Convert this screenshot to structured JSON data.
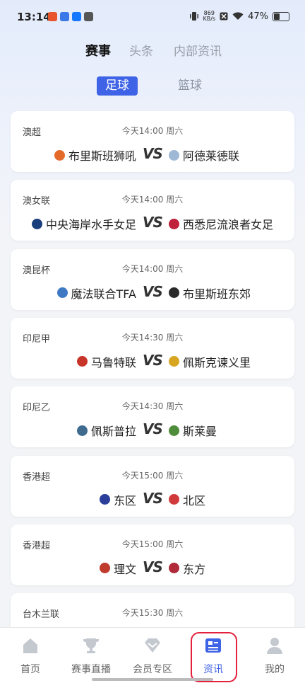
{
  "status": {
    "time": "13:14",
    "net_speed_value": "869",
    "net_speed_unit": "KB/s",
    "battery": "47%",
    "battery_level": 0.47
  },
  "top_tabs": [
    "赛事",
    "头条",
    "内部资讯"
  ],
  "sub_tabs": [
    "足球",
    "篮球"
  ],
  "vs_text": "VS",
  "matches": [
    {
      "league": "澳超",
      "time": "今天14:00 周六",
      "home": "布里斯班狮吼",
      "away": "阿德莱德联",
      "home_color": "#e46a2a",
      "away_color": "#9fb8d6"
    },
    {
      "league": "澳女联",
      "time": "今天14:00 周六",
      "home": "中央海岸水手女足",
      "away": "西悉尼流浪者女足",
      "home_color": "#1a3d7c",
      "away_color": "#c0213a"
    },
    {
      "league": "澳昆杯",
      "time": "今天14:00 周六",
      "home": "魔法联合TFA",
      "away": "布里斯班东郊",
      "home_color": "#3f79c4",
      "away_color": "#2a2a2a"
    },
    {
      "league": "印尼甲",
      "time": "今天14:30 周六",
      "home": "马鲁特联",
      "away": "佩斯克谏义里",
      "home_color": "#c7342a",
      "away_color": "#d8a521"
    },
    {
      "league": "印尼乙",
      "time": "今天14:30 周六",
      "home": "佩斯普拉",
      "away": "斯莱曼",
      "home_color": "#3f6b8f",
      "away_color": "#4f8d3a"
    },
    {
      "league": "香港超",
      "time": "今天15:00 周六",
      "home": "东区",
      "away": "北区",
      "home_color": "#2a3e9a",
      "away_color": "#d13a3a"
    },
    {
      "league": "香港超",
      "time": "今天15:00 周六",
      "home": "理文",
      "away": "东方",
      "home_color": "#c03a2e",
      "away_color": "#b02a3a"
    },
    {
      "league": "台木兰联",
      "time": "今天15:30 周六",
      "home": "",
      "away": "",
      "home_color": "#cccccc",
      "away_color": "#cccccc"
    }
  ],
  "bottom_nav": [
    {
      "label": "首页",
      "icon": "home-icon"
    },
    {
      "label": "赛事直播",
      "icon": "trophy-icon"
    },
    {
      "label": "会员专区",
      "icon": "diamond-icon"
    },
    {
      "label": "资讯",
      "icon": "news-icon",
      "active": true
    },
    {
      "label": "我的",
      "icon": "user-icon"
    }
  ],
  "colors": {
    "accent": "#3f63e6",
    "highlight": "#e3213c"
  }
}
